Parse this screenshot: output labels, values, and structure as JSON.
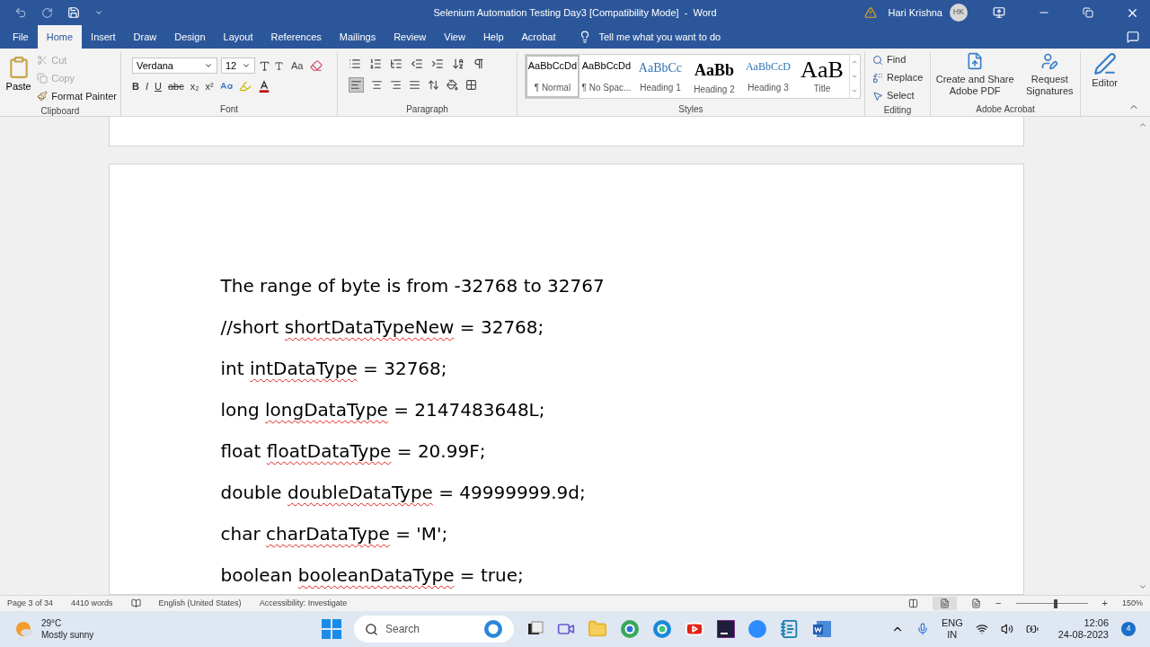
{
  "title_bar": {
    "title": "Selenium Automation Testing Day3 [Compatibility Mode]  -  Word",
    "user_name": "Hari Krishna",
    "avatar_initials": "HK"
  },
  "tabs": [
    {
      "label": "File",
      "selected": false
    },
    {
      "label": "Home",
      "selected": true
    },
    {
      "label": "Insert",
      "selected": false
    },
    {
      "label": "Draw",
      "selected": false
    },
    {
      "label": "Design",
      "selected": false
    },
    {
      "label": "Layout",
      "selected": false
    },
    {
      "label": "References",
      "selected": false
    },
    {
      "label": "Mailings",
      "selected": false
    },
    {
      "label": "Review",
      "selected": false
    },
    {
      "label": "View",
      "selected": false
    },
    {
      "label": "Help",
      "selected": false
    },
    {
      "label": "Acrobat",
      "selected": false
    }
  ],
  "tell_me": "Tell me what you want to do",
  "ribbon": {
    "clipboard": {
      "label": "Clipboard",
      "paste": "Paste",
      "items": [
        {
          "label": "Cut",
          "kind": "cut",
          "disabled": true
        },
        {
          "label": "Copy",
          "kind": "copy",
          "disabled": true
        },
        {
          "label": "Format Painter",
          "kind": "painter",
          "disabled": false
        }
      ]
    },
    "font": {
      "label": "Font",
      "font_name": "Verdana",
      "font_size": "12",
      "change_case": "Aa",
      "format_buttons": [
        "B",
        "I",
        "U",
        "abc",
        "x₂",
        "x²"
      ]
    },
    "paragraph": {
      "label": "Paragraph"
    },
    "styles": {
      "label": "Styles",
      "items": [
        {
          "preview": "AaBbCcDd",
          "name": "¶ Normal",
          "kind": "plain",
          "selected": true
        },
        {
          "preview": "AaBbCcDd",
          "name": "¶ No Spac...",
          "kind": "plain",
          "selected": false
        },
        {
          "preview": "AaBbCc",
          "name": "Heading 1",
          "kind": "heading1",
          "selected": false
        },
        {
          "preview": "AaBb",
          "name": "Heading 2",
          "kind": "heading2",
          "selected": false
        },
        {
          "preview": "AaBbCcD",
          "name": "Heading 3",
          "kind": "heading3",
          "selected": false
        },
        {
          "preview": "AaB",
          "name": "Title",
          "kind": "title",
          "selected": false
        }
      ]
    },
    "editing": {
      "label": "Editing",
      "items": [
        {
          "label": "Find",
          "kind": "find"
        },
        {
          "label": "Replace",
          "kind": "replace"
        },
        {
          "label": "Select",
          "kind": "select"
        }
      ]
    },
    "acrobat": {
      "label": "Adobe Acrobat",
      "items": [
        {
          "label": "Create and Share Adobe PDF",
          "kind": "pdf"
        },
        {
          "label": "Request Signatures",
          "kind": "sign"
        }
      ]
    },
    "editor": "Editor"
  },
  "document": {
    "lines": [
      [
        {
          "text": "The range of byte is from -32768 to 32767",
          "misspelled": false
        }
      ],
      [
        {
          "text": "//short ",
          "misspelled": false
        },
        {
          "text": "shortDataTypeNew",
          "misspelled": true
        },
        {
          "text": " = 32768;",
          "misspelled": false
        }
      ],
      [
        {
          "text": "int ",
          "misspelled": false
        },
        {
          "text": "intDataType",
          "misspelled": true
        },
        {
          "text": " = 32768;",
          "misspelled": false
        }
      ],
      [
        {
          "text": "long ",
          "misspelled": false
        },
        {
          "text": "longDataType",
          "misspelled": true
        },
        {
          "text": " = 2147483648L;",
          "misspelled": false
        }
      ],
      [
        {
          "text": "float ",
          "misspelled": false
        },
        {
          "text": "floatDataType",
          "misspelled": true
        },
        {
          "text": " = 20.99F;",
          "misspelled": false
        }
      ],
      [
        {
          "text": "double ",
          "misspelled": false
        },
        {
          "text": "doubleDataType",
          "misspelled": true
        },
        {
          "text": " = 49999999.9d;",
          "misspelled": false
        }
      ],
      [
        {
          "text": "char ",
          "misspelled": false
        },
        {
          "text": "charDataType",
          "misspelled": true
        },
        {
          "text": " = 'M';",
          "misspelled": false
        }
      ],
      [
        {
          "text": "boolean ",
          "misspelled": false
        },
        {
          "text": "booleanDataType",
          "misspelled": true
        },
        {
          "text": " = true;",
          "misspelled": false
        }
      ]
    ]
  },
  "status_bar": {
    "page": "Page 3 of 34",
    "words": "4410 words",
    "language": "English (United States)",
    "accessibility": "Accessibility: Investigate",
    "zoom": {
      "out": "−",
      "in": "+",
      "level": 0.55,
      "reading": "150%"
    }
  },
  "taskbar": {
    "weather": {
      "temperature": "29°C",
      "condition": "Mostly sunny"
    },
    "search": {
      "placeholder": "Search"
    },
    "tray": {
      "language": "ENG",
      "region": "IN",
      "time": "12:06",
      "date": "24-08-2023",
      "notifications": "4"
    }
  }
}
